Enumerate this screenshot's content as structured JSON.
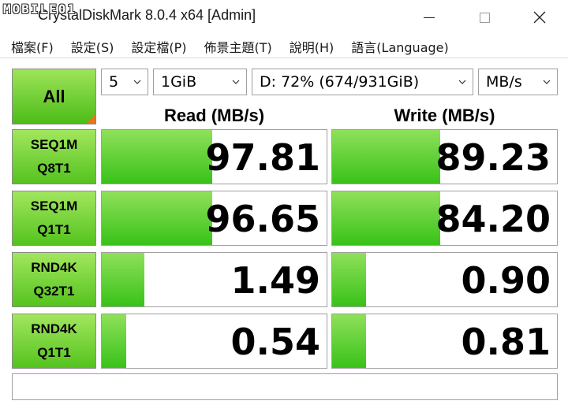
{
  "window": {
    "watermark": "MOBILE01",
    "title": "CrystalDiskMark 8.0.4 x64 [Admin]"
  },
  "menu": [
    "檔案(F)",
    "設定(S)",
    "設定檔(P)",
    "佈景主題(T)",
    "說明(H)",
    "語言(Language)"
  ],
  "controls": {
    "all_label": "All",
    "count": "5",
    "size": "1GiB",
    "drive": "D: 72% (674/931GiB)",
    "unit": "MB/s"
  },
  "headers": {
    "read": "Read (MB/s)",
    "write": "Write (MB/s)"
  },
  "tests": [
    {
      "line1": "SEQ1M",
      "line2": "Q8T1",
      "read": "97.81",
      "write": "89.23",
      "read_fill": 0.49,
      "write_fill": 0.48
    },
    {
      "line1": "SEQ1M",
      "line2": "Q1T1",
      "read": "96.65",
      "write": "84.20",
      "read_fill": 0.49,
      "write_fill": 0.48
    },
    {
      "line1": "RND4K",
      "line2": "Q32T1",
      "read": "1.49",
      "write": "0.90",
      "read_fill": 0.19,
      "write_fill": 0.15
    },
    {
      "line1": "RND4K",
      "line2": "Q1T1",
      "read": "0.54",
      "write": "0.81",
      "read_fill": 0.11,
      "write_fill": 0.15
    }
  ],
  "status_text": ""
}
